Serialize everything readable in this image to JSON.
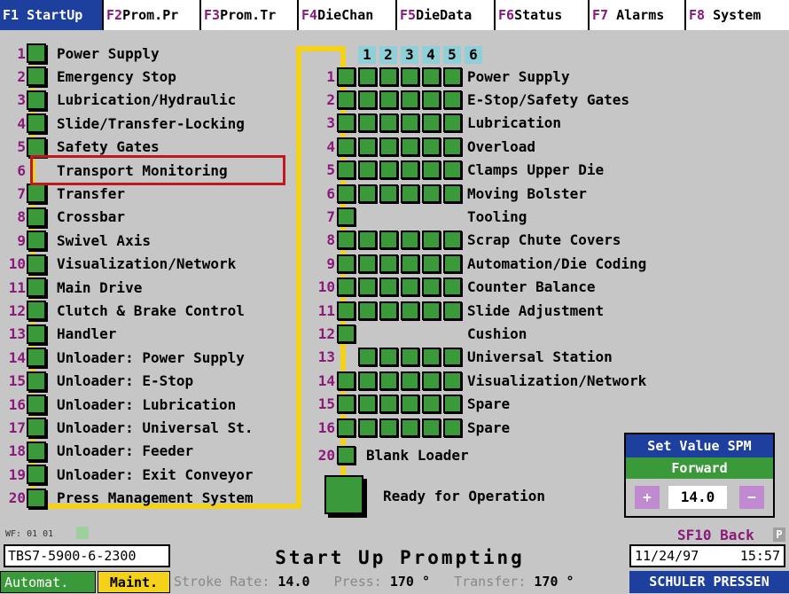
{
  "tabs": [
    {
      "key": "F1",
      "label": "StartUp",
      "active": true
    },
    {
      "key": "F2",
      "label": "Prom.Pr"
    },
    {
      "key": "F3",
      "label": "Prom.Tr"
    },
    {
      "key": "F4",
      "label": "DieChan"
    },
    {
      "key": "F5",
      "label": "DieData"
    },
    {
      "key": "F6",
      "label": "Status"
    },
    {
      "key": "F7",
      "label": "Alarms"
    },
    {
      "key": "F8",
      "label": "System"
    }
  ],
  "left_list": [
    {
      "num": "1",
      "label": "Power Supply"
    },
    {
      "num": "2",
      "label": "Emergency Stop"
    },
    {
      "num": "3",
      "label": "Lubrication/Hydraulic"
    },
    {
      "num": "4",
      "label": "Slide/Transfer-Locking"
    },
    {
      "num": "5",
      "label": "Safety Gates"
    },
    {
      "num": "6",
      "label": "Transport Monitoring",
      "status": "off"
    },
    {
      "num": "7",
      "label": "Transfer"
    },
    {
      "num": "8",
      "label": "Crossbar"
    },
    {
      "num": "9",
      "label": "Swivel Axis"
    },
    {
      "num": "10",
      "label": "Visualization/Network"
    },
    {
      "num": "11",
      "label": "Main Drive"
    },
    {
      "num": "12",
      "label": "Clutch & Brake Control"
    },
    {
      "num": "13",
      "label": "Handler"
    },
    {
      "num": "14",
      "label": "Unloader: Power Supply"
    },
    {
      "num": "15",
      "label": "Unloader: E-Stop"
    },
    {
      "num": "16",
      "label": "Unloader: Lubrication"
    },
    {
      "num": "17",
      "label": "Unloader: Universal St."
    },
    {
      "num": "18",
      "label": "Unloader: Feeder"
    },
    {
      "num": "19",
      "label": "Unloader: Exit Conveyor"
    },
    {
      "num": "20",
      "label": "Press Management System"
    }
  ],
  "column_headers": [
    "1",
    "2",
    "3",
    "4",
    "5",
    "6"
  ],
  "right_list": [
    {
      "num": "1",
      "label": "Power Supply",
      "cells": [
        1,
        1,
        1,
        1,
        1,
        1
      ]
    },
    {
      "num": "2",
      "label": "E-Stop/Safety Gates",
      "cells": [
        1,
        1,
        1,
        1,
        1,
        1
      ]
    },
    {
      "num": "3",
      "label": "Lubrication",
      "cells": [
        1,
        1,
        1,
        1,
        1,
        1
      ]
    },
    {
      "num": "4",
      "label": "Overload",
      "cells": [
        1,
        1,
        1,
        1,
        1,
        1
      ]
    },
    {
      "num": "5",
      "label": "Clamps Upper Die",
      "cells": [
        1,
        1,
        1,
        1,
        1,
        1
      ]
    },
    {
      "num": "6",
      "label": "Moving Bolster",
      "cells": [
        1,
        1,
        1,
        1,
        1,
        1
      ]
    },
    {
      "num": "7",
      "label": "Tooling",
      "cells": [
        1,
        0,
        0,
        0,
        0,
        0
      ]
    },
    {
      "num": "8",
      "label": "Scrap Chute Covers",
      "cells": [
        1,
        1,
        1,
        1,
        1,
        1
      ]
    },
    {
      "num": "9",
      "label": "Automation/Die Coding",
      "cells": [
        1,
        1,
        1,
        1,
        1,
        1
      ]
    },
    {
      "num": "10",
      "label": "Counter Balance",
      "cells": [
        1,
        1,
        1,
        1,
        1,
        1
      ]
    },
    {
      "num": "11",
      "label": "Slide Adjustment",
      "cells": [
        1,
        1,
        1,
        1,
        1,
        1
      ]
    },
    {
      "num": "12",
      "label": "Cushion",
      "cells": [
        1,
        0,
        0,
        0,
        0,
        0
      ]
    },
    {
      "num": "13",
      "label": "Universal Station",
      "cells": [
        0,
        1,
        1,
        1,
        1,
        1
      ]
    },
    {
      "num": "14",
      "label": "Visualization/Network",
      "cells": [
        1,
        1,
        1,
        1,
        1,
        1
      ]
    },
    {
      "num": "15",
      "label": "Spare",
      "cells": [
        1,
        1,
        1,
        1,
        1,
        1
      ]
    },
    {
      "num": "16",
      "label": "Spare",
      "cells": [
        1,
        1,
        1,
        1,
        1,
        1
      ]
    }
  ],
  "blank_loader": {
    "num": "20",
    "label": "Blank Loader"
  },
  "ready": {
    "label": "Ready for Operation"
  },
  "spm": {
    "title": "Set Value SPM",
    "mode": "Forward",
    "plus": "+",
    "value": "14.0",
    "minus": "−"
  },
  "wf_label": "WF: 01 01",
  "back": {
    "label": "SF10 Back",
    "indicator": "P"
  },
  "status": {
    "program_id": "TBS7-5900-6-2300",
    "title": "Start Up Prompting",
    "date": "11/24/97",
    "time": "15:57",
    "mode_auto": "Automat.",
    "mode_maint": "Maint.",
    "stroke_label": "Stroke Rate:",
    "stroke_value": "14.0",
    "press_label": "Press:",
    "press_value": "170 °",
    "transfer_label": "Transfer:",
    "transfer_value": "170 °",
    "brand": "SCHULER PRESSEN"
  },
  "colors": {
    "tab_active": "#1d3f9e",
    "ok_green": "#3a9a3a",
    "wire_yellow": "#f4d21a",
    "highlight_red": "#c0181e",
    "number_purple": "#8a1a7a",
    "header_cyan": "#8fd0d8"
  }
}
